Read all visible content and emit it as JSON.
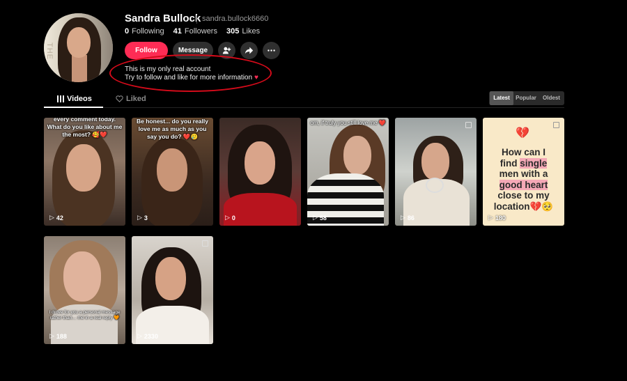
{
  "profile": {
    "name": "Sandra Bullock",
    "handle": "sandra.bullock6660",
    "following_count": "0",
    "following_label": "Following",
    "followers_count": "41",
    "followers_label": "Followers",
    "likes_count": "305",
    "likes_label": "Likes",
    "bio_line1": "This is my only real account",
    "bio_line2": "Try to follow and like for more information",
    "bio_heart": "♥"
  },
  "actions": {
    "follow_label": "Follow",
    "message_label": "Message",
    "add_friend_icon": "add-person-icon",
    "share_icon": "share-arrow-icon",
    "more_icon": "more-dots-icon"
  },
  "tabs": {
    "videos_label": "Videos",
    "liked_label": "Liked"
  },
  "sort": {
    "options": [
      "Latest",
      "Popular",
      "Oldest"
    ],
    "selected": "Latest"
  },
  "videos": [
    {
      "views": "42",
      "caption": "every comment today. What do you like about me the most? 🥰❤️"
    },
    {
      "views": "3",
      "caption": "Be honest... do you really love me as much as you say you do? ❤️🥲"
    },
    {
      "views": "0",
      "caption": ""
    },
    {
      "views": "58",
      "caption": "om, if truly you still love me ❤️"
    },
    {
      "views": "86",
      "caption": ""
    },
    {
      "views": "180",
      "caption": "How can I find single men with a good heart close to my location 💔🥺",
      "text_card": true
    },
    {
      "views": "188",
      "caption": "I drove for you a personal message rather than… me in a real reply 🧡"
    },
    {
      "views": "2330",
      "caption": ""
    }
  ],
  "text_card": {
    "icon": "💔",
    "words": [
      "How can I",
      "find",
      "single",
      "men with a",
      "good heart",
      "close to my",
      "location",
      "💔🥺"
    ]
  },
  "colors": {
    "accent": "#fe2c55",
    "annotation_circle": "#d40b1a",
    "background": "#000000"
  }
}
